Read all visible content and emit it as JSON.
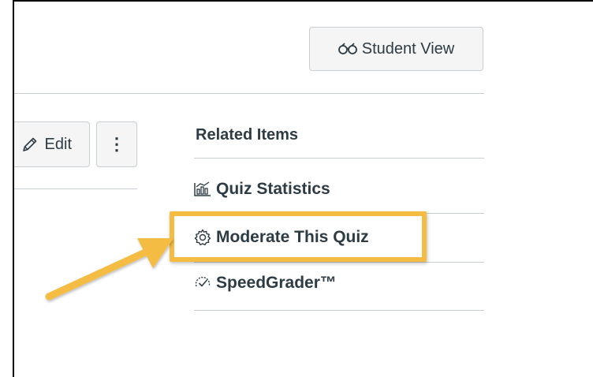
{
  "header": {
    "student_view_label": "Student View",
    "student_view_icon": "glasses-icon"
  },
  "toolbar": {
    "edit_label": "Edit",
    "edit_icon": "pencil-icon",
    "more_label": "⋮",
    "more_icon": "kebab-menu-icon"
  },
  "related_items": {
    "heading": "Related Items",
    "items": [
      {
        "label": "Quiz Statistics",
        "icon": "statistics-icon"
      },
      {
        "label": "Moderate This Quiz",
        "icon": "gear-icon",
        "highlighted": true
      },
      {
        "label": "SpeedGrader™",
        "icon": "speedgrader-icon"
      }
    ]
  },
  "annotation": {
    "highlight_color": "#f4bc42",
    "arrow_color": "#f4bc42",
    "points_to": "Moderate This Quiz"
  },
  "colors": {
    "text": "#2d3b45",
    "button_bg": "#f5f5f5",
    "border": "#c7cdd1"
  }
}
